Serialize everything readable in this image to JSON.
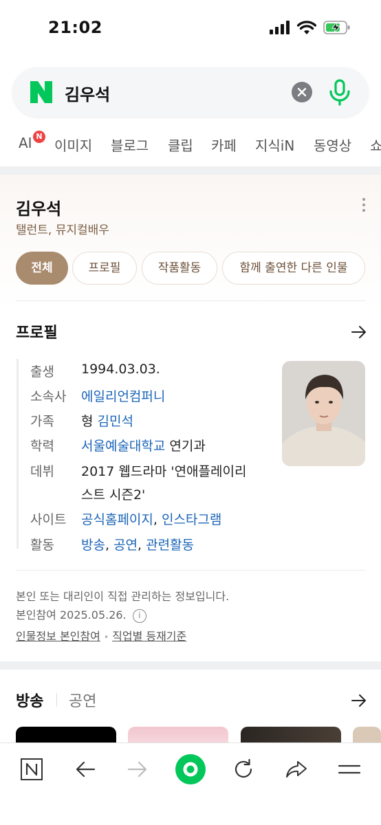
{
  "status_bar": {
    "time": "21:02"
  },
  "search": {
    "query": "김우석"
  },
  "tabs": [
    {
      "label": "AI",
      "badge": "N"
    },
    {
      "label": "이미지"
    },
    {
      "label": "블로그"
    },
    {
      "label": "클립"
    },
    {
      "label": "카페"
    },
    {
      "label": "지식iN"
    },
    {
      "label": "동영상"
    },
    {
      "label": "쇼"
    }
  ],
  "entity": {
    "name": "김우석",
    "subtitle": "탤런트, 뮤지컬배우",
    "chips": [
      "전체",
      "프로필",
      "작품활동",
      "함께 출연한 다른 인물"
    ],
    "active_chip": "전체"
  },
  "profile": {
    "title": "프로필",
    "rows": {
      "birth": {
        "label": "출생",
        "value": "1994.03.03."
      },
      "agency": {
        "label": "소속사",
        "value": "에일리언컴퍼니"
      },
      "family": {
        "label": "가족",
        "prefix": "형",
        "value": "김민석"
      },
      "education": {
        "label": "학력",
        "value": "서울예술대학교",
        "suffix": "연기과"
      },
      "debut": {
        "label": "데뷔",
        "line1": "2017 웹드라마 '연애플레이리",
        "line2": "스트 시즌2'"
      },
      "site": {
        "label": "사이트",
        "link1": "공식홈페이지",
        "sep": ",",
        "link2": "인스타그램"
      },
      "activity": {
        "label": "활동",
        "link1": "방송",
        "link2": "공연",
        "link3": "관련활동",
        "sep": ","
      }
    },
    "note_line1": "본인 또는 대리인이 직접 관리하는 정보입니다.",
    "note_line2": "본인참여 2025.05.26.",
    "info_icon": "i",
    "link1": "인물정보 본인참여",
    "dot": "•",
    "link2": "직업별 등재기준"
  },
  "works": {
    "tab_active": "방송",
    "tab_inactive": "공연"
  },
  "colors": {
    "naver_green": "#03c75a",
    "accent_brown": "#a98b6e",
    "link_blue": "#1a64b8",
    "badge_red": "#ef4343"
  }
}
